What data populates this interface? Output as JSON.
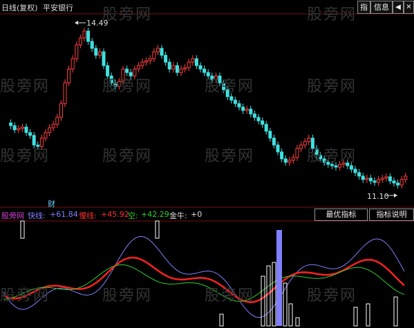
{
  "header": {
    "period_label": "日线(复权)",
    "stock_name": "平安银行",
    "btn_indicator": "指",
    "btn_info": "信息",
    "btn_sound_icon": "speaker-icon",
    "btn_close_icon": "close-icon"
  },
  "price_panel": {
    "max_label": "14.49",
    "min_label": "11.10",
    "finance_marker": "财"
  },
  "indicator": {
    "name": "股旁网",
    "fast_label": "快线:",
    "fast_value": "+61.84",
    "slow_label": "慢线:",
    "slow_value": "+45.92",
    "empty_label": "空:",
    "empty_value": "+42.29",
    "bull_label": "金牛:",
    "bull_value": "+0",
    "btn_best": "最优指标",
    "btn_help": "指标说明"
  },
  "watermark": "股旁网",
  "colors": {
    "up": "#ff4040",
    "down": "#40e0e0",
    "fast": "#8080ff",
    "slow": "#ff2020",
    "empty": "#30d030",
    "bull_bar": "#ffffff"
  }
}
